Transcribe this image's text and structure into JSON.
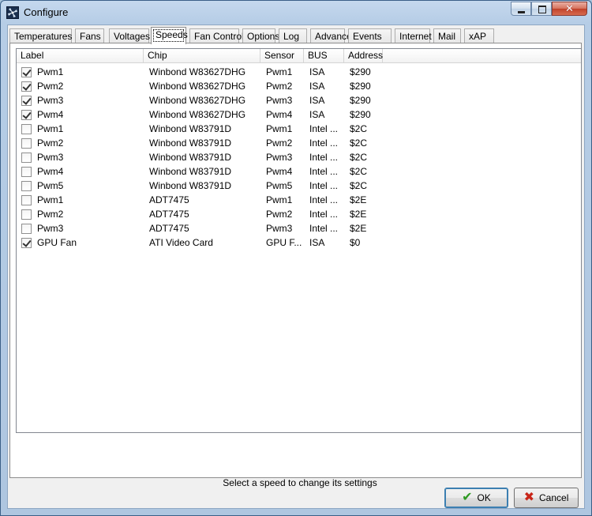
{
  "window": {
    "title": "Configure"
  },
  "tabs": [
    "Temperatures",
    "Fans",
    "Voltages",
    "Speeds",
    "Fan Control",
    "Options",
    "Log",
    "Advanced",
    "Events",
    "Internet",
    "Mail",
    "xAP"
  ],
  "active_tab": "Speeds",
  "table": {
    "columns": [
      "Label",
      "Chip",
      "Sensor",
      "BUS",
      "Address"
    ],
    "rows": [
      {
        "checked": true,
        "label": "Pwm1",
        "chip": "Winbond W83627DHG",
        "sensor": "Pwm1",
        "bus": "ISA",
        "address": "$290"
      },
      {
        "checked": true,
        "label": "Pwm2",
        "chip": "Winbond W83627DHG",
        "sensor": "Pwm2",
        "bus": "ISA",
        "address": "$290"
      },
      {
        "checked": true,
        "label": "Pwm3",
        "chip": "Winbond W83627DHG",
        "sensor": "Pwm3",
        "bus": "ISA",
        "address": "$290"
      },
      {
        "checked": true,
        "label": "Pwm4",
        "chip": "Winbond W83627DHG",
        "sensor": "Pwm4",
        "bus": "ISA",
        "address": "$290"
      },
      {
        "checked": false,
        "label": "Pwm1",
        "chip": "Winbond W83791D",
        "sensor": "Pwm1",
        "bus": "Intel ...",
        "address": "$2C"
      },
      {
        "checked": false,
        "label": "Pwm2",
        "chip": "Winbond W83791D",
        "sensor": "Pwm2",
        "bus": "Intel ...",
        "address": "$2C"
      },
      {
        "checked": false,
        "label": "Pwm3",
        "chip": "Winbond W83791D",
        "sensor": "Pwm3",
        "bus": "Intel ...",
        "address": "$2C"
      },
      {
        "checked": false,
        "label": "Pwm4",
        "chip": "Winbond W83791D",
        "sensor": "Pwm4",
        "bus": "Intel ...",
        "address": "$2C"
      },
      {
        "checked": false,
        "label": "Pwm5",
        "chip": "Winbond W83791D",
        "sensor": "Pwm5",
        "bus": "Intel ...",
        "address": "$2C"
      },
      {
        "checked": false,
        "label": "Pwm1",
        "chip": "ADT7475",
        "sensor": "Pwm1",
        "bus": "Intel ...",
        "address": "$2E"
      },
      {
        "checked": false,
        "label": "Pwm2",
        "chip": "ADT7475",
        "sensor": "Pwm2",
        "bus": "Intel ...",
        "address": "$2E"
      },
      {
        "checked": false,
        "label": "Pwm3",
        "chip": "ADT7475",
        "sensor": "Pwm3",
        "bus": "Intel ...",
        "address": "$2E"
      },
      {
        "checked": true,
        "label": "GPU Fan",
        "chip": "ATI Video Card",
        "sensor": "GPU F...",
        "bus": "ISA",
        "address": "$0"
      }
    ]
  },
  "status_text": "Select a speed to change its settings",
  "buttons": {
    "ok": "OK",
    "cancel": "Cancel"
  },
  "icons": {
    "app": "speedfan-icon",
    "ok": "checkmark-icon",
    "cancel": "x-icon"
  }
}
